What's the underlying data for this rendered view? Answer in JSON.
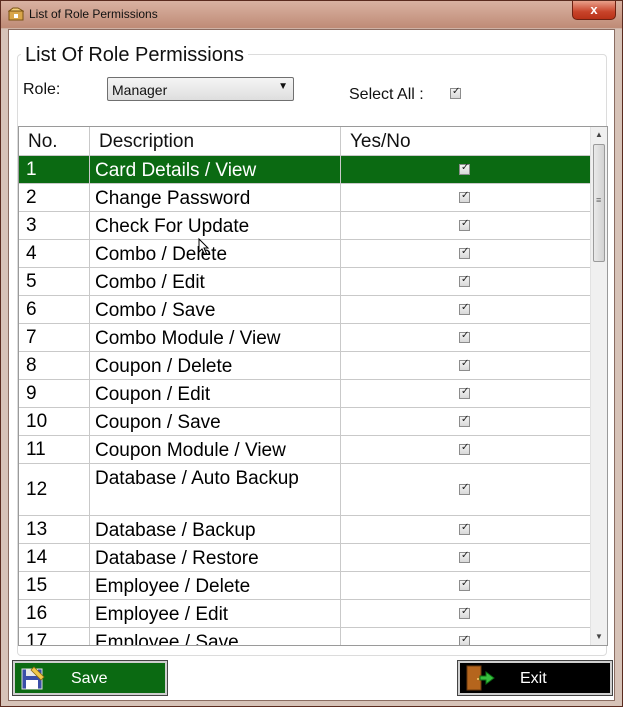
{
  "window": {
    "title": "List of Role Permissions",
    "close_label": "x"
  },
  "group": {
    "title": "List Of Role Permissions",
    "role_label": "Role:",
    "role_value": "Manager",
    "select_all_label": "Select All :",
    "select_all_checked": true
  },
  "grid": {
    "headers": [
      "No.",
      "Description",
      "Yes/No"
    ],
    "rows": [
      {
        "no": "1",
        "description": "Card Details / View",
        "checked": true,
        "selected": true
      },
      {
        "no": "2",
        "description": "Change Password",
        "checked": true
      },
      {
        "no": "3",
        "description": "Check For Update",
        "checked": true
      },
      {
        "no": "4",
        "description": "Combo / Delete",
        "checked": true
      },
      {
        "no": "5",
        "description": "Combo / Edit",
        "checked": true
      },
      {
        "no": "6",
        "description": "Combo / Save",
        "checked": true
      },
      {
        "no": "7",
        "description": "Combo Module / View",
        "checked": true
      },
      {
        "no": "8",
        "description": "Coupon / Delete",
        "checked": true
      },
      {
        "no": "9",
        "description": "Coupon / Edit",
        "checked": true
      },
      {
        "no": "10",
        "description": "Coupon / Save",
        "checked": true
      },
      {
        "no": "11",
        "description": "Coupon Module / View",
        "checked": true
      },
      {
        "no": "12",
        "description": "Database / Auto Backup",
        "checked": true,
        "tall": true
      },
      {
        "no": "13",
        "description": "Database / Backup",
        "checked": true
      },
      {
        "no": "14",
        "description": "Database / Restore",
        "checked": true
      },
      {
        "no": "15",
        "description": "Employee / Delete",
        "checked": true
      },
      {
        "no": "16",
        "description": "Employee / Edit",
        "checked": true
      },
      {
        "no": "17",
        "description": "Employee / Save",
        "checked": true
      }
    ]
  },
  "buttons": {
    "save_label": "Save",
    "exit_label": "Exit"
  },
  "colors": {
    "selected_row": "#0b6a12",
    "save_button": "#0b6a12",
    "exit_button": "#000000"
  },
  "icons": {
    "app": "app-icon",
    "save": "floppy-disk-icon",
    "exit": "exit-door-icon"
  }
}
